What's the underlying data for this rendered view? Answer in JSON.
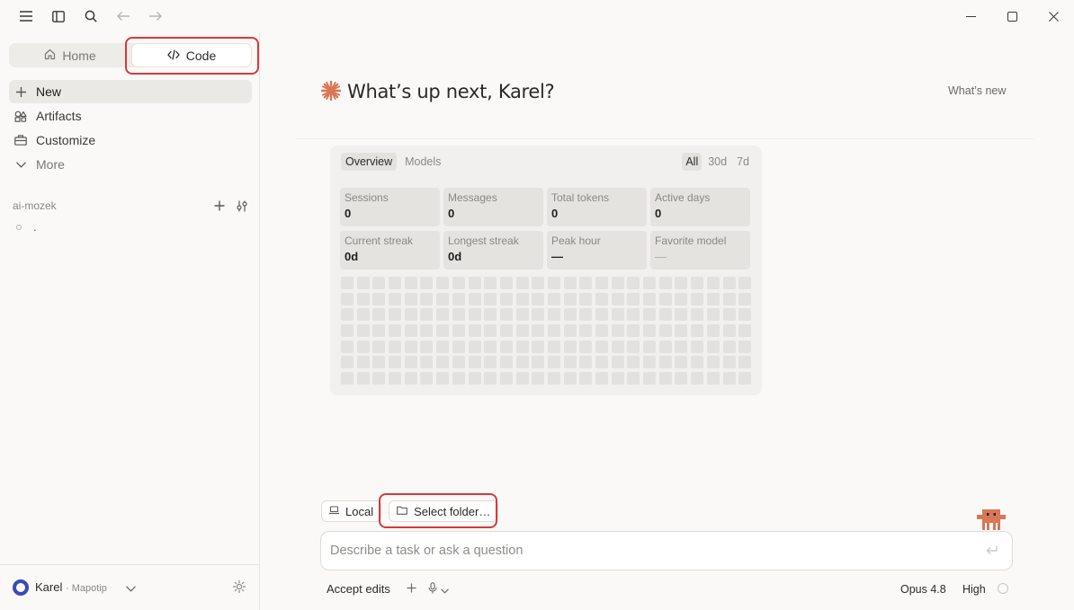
{
  "titlebar": {
    "icons": [
      "menu-icon",
      "sidebar-toggle-icon",
      "search-icon",
      "back-arrow-icon",
      "forward-arrow-icon"
    ],
    "window_controls": [
      "minimize-icon",
      "maximize-icon",
      "close-icon"
    ]
  },
  "sidebar": {
    "modes": {
      "home": "Home",
      "code": "Code"
    },
    "nav": {
      "new": "New",
      "artifacts": "Artifacts",
      "customize": "Customize",
      "more": "More"
    },
    "project": {
      "name": "ai-mozek"
    },
    "sessions": [
      "."
    ],
    "account": {
      "name": "Karel",
      "org": "· Mapotip"
    }
  },
  "main": {
    "greeting": "What’s up next, Karel?",
    "whats_new": "What’s new",
    "stats": {
      "tabs": [
        "Overview",
        "Models"
      ],
      "active_tab": "Overview",
      "ranges": [
        "All",
        "30d",
        "7d"
      ],
      "active_range": "All",
      "cards": [
        {
          "label": "Sessions",
          "value": "0"
        },
        {
          "label": "Messages",
          "value": "0"
        },
        {
          "label": "Total tokens",
          "value": "0"
        },
        {
          "label": "Active days",
          "value": "0"
        },
        {
          "label": "Current streak",
          "value": "0d"
        },
        {
          "label": "Longest streak",
          "value": "0d"
        },
        {
          "label": "Peak hour",
          "value": "—"
        },
        {
          "label": "Favorite model",
          "value": "—"
        }
      ]
    },
    "chips": {
      "local": "Local",
      "folder": "Select folder…"
    },
    "composer": {
      "placeholder": "Describe a task or ask a question"
    },
    "bottom": {
      "accept_edits": "Accept edits",
      "model": "Opus 4.8",
      "effort": "High"
    }
  },
  "colors": {
    "accent": "#d97757",
    "highlight": "#d9383a",
    "avatar": "#3b4bb5"
  }
}
